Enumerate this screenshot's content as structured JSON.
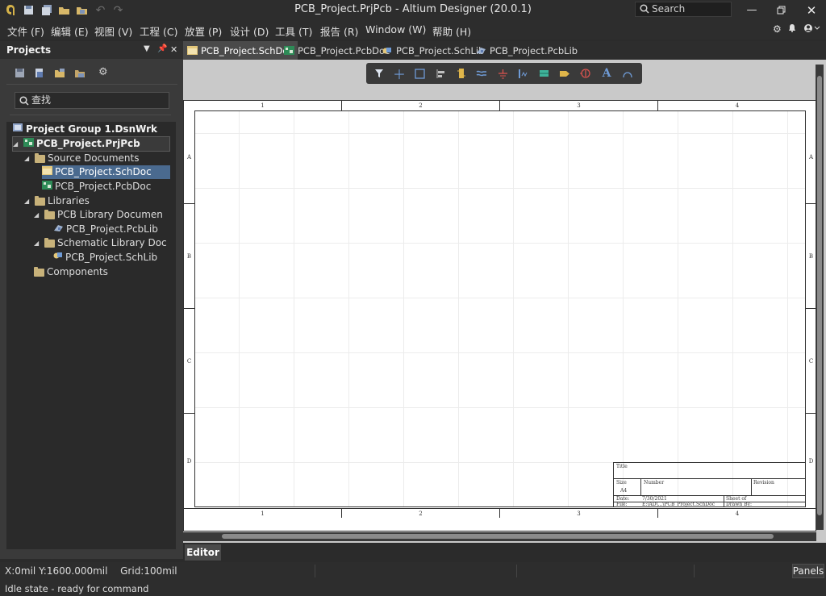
{
  "window": {
    "title": "PCB_Project.PrjPcb - Altium Designer (20.0.1)",
    "search_placeholder": "Search"
  },
  "menu": [
    "文件 (F)",
    "编辑 (E)",
    "视图 (V)",
    "工程 (C)",
    "放置 (P)",
    "设计 (D)",
    "工具 (T)",
    "报告 (R)",
    "Window (W)",
    "帮助 (H)"
  ],
  "projects_panel": {
    "title": "Projects",
    "search_placeholder": "查找",
    "tree": [
      {
        "label": "Project Group 1.DsnWrk",
        "bold": true
      },
      {
        "label": "PCB_Project.PrjPcb",
        "bold": true
      },
      {
        "label": "Source Documents"
      },
      {
        "label": "PCB_Project.SchDoc",
        "selected": true
      },
      {
        "label": "PCB_Project.PcbDoc"
      },
      {
        "label": "Libraries"
      },
      {
        "label": "PCB Library Documen"
      },
      {
        "label": "PCB_Project.PcbLib"
      },
      {
        "label": "Schematic Library Doc"
      },
      {
        "label": "PCB_Project.SchLib"
      },
      {
        "label": "Components"
      }
    ]
  },
  "doc_tabs": [
    {
      "label": "PCB_Project.SchDoc",
      "active": true
    },
    {
      "label": "PCB_Project.PcbDoc"
    },
    {
      "label": "PCB_Project.SchLib"
    },
    {
      "label": "PCB_Project.PcbLib"
    }
  ],
  "sheet": {
    "columns": [
      "1",
      "2",
      "3",
      "4"
    ],
    "rows": [
      "A",
      "B",
      "C",
      "D"
    ],
    "titleblock": {
      "title_label": "Title",
      "size_label": "Size",
      "size_value": "A4",
      "number_label": "Number",
      "revision_label": "Revision",
      "date_label": "Date:",
      "date_value": "7/30/2021",
      "file_label": "File:",
      "file_value": "E:\\AD\\...\\PCB_Project.SchDoc",
      "sheet_label": "Sheet   of",
      "drawn_label": "Drawn By:"
    }
  },
  "editor_tab": "Editor",
  "status": {
    "coords": "X:0mil Y:1600.000mil",
    "grid": "Grid:100mil",
    "state": "Idle state - ready for command",
    "panels_button": "Panels"
  },
  "colors": {
    "accent_selection": "#4a6a8f",
    "folder": "#c8b27a"
  }
}
